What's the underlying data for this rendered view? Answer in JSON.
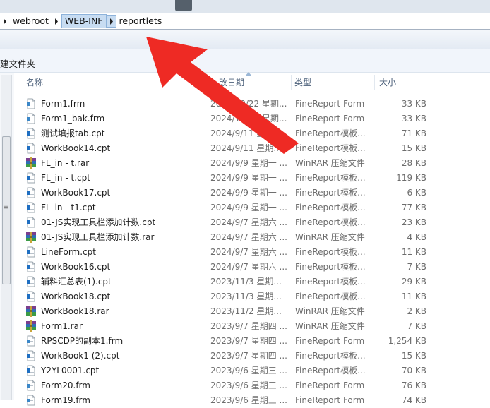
{
  "breadcrumb": {
    "items": [
      {
        "label": "webroot",
        "active": false
      },
      {
        "label": "WEB-INF",
        "active": true
      },
      {
        "label": "reportlets",
        "active": false
      }
    ]
  },
  "commandbar": {
    "new_folder": "建文件夹"
  },
  "columns": {
    "name": "名称",
    "date": "改日期",
    "type": "类型",
    "size": "大小"
  },
  "files": [
    {
      "name": "Form1.frm",
      "date": "2024/10/22 星期...",
      "type": "FineReport Form",
      "size": "33 KB",
      "icon": "frm-file-icon"
    },
    {
      "name": "Form1_bak.frm",
      "date": "2024/10/22 星期...",
      "type": "FineReport Form",
      "size": "33 KB",
      "icon": "frm-file-icon"
    },
    {
      "name": "测试填报tab.cpt",
      "date": "2024/9/11 星期...",
      "type": "FineReport模板...",
      "size": "71 KB",
      "icon": "cpt-file-icon"
    },
    {
      "name": "WorkBook14.cpt",
      "date": "2024/9/11 星期...",
      "type": "FineReport模板...",
      "size": "15 KB",
      "icon": "cpt-file-icon"
    },
    {
      "name": "FL_in - t.rar",
      "date": "2024/9/9 星期一 ...",
      "type": "WinRAR 压缩文件",
      "size": "28 KB",
      "icon": "rar-file-icon"
    },
    {
      "name": "FL_in - t.cpt",
      "date": "2024/9/9 星期一 ...",
      "type": "FineReport模板...",
      "size": "119 KB",
      "icon": "cpt-file-icon"
    },
    {
      "name": "WorkBook17.cpt",
      "date": "2024/9/9 星期一 ...",
      "type": "FineReport模板...",
      "size": "6 KB",
      "icon": "cpt-file-icon"
    },
    {
      "name": "FL_in - t1.cpt",
      "date": "2024/9/9 星期一 ...",
      "type": "FineReport模板...",
      "size": "77 KB",
      "icon": "cpt-file-icon"
    },
    {
      "name": "01-JS实现工具栏添加计数.cpt",
      "date": "2024/9/7 星期六 ...",
      "type": "FineReport模板...",
      "size": "23 KB",
      "icon": "cpt-file-icon"
    },
    {
      "name": "01-JS实现工具栏添加计数.rar",
      "date": "2024/9/7 星期六 ...",
      "type": "WinRAR 压缩文件",
      "size": "4 KB",
      "icon": "rar-file-icon"
    },
    {
      "name": "LineForm.cpt",
      "date": "2024/9/7 星期六 ...",
      "type": "FineReport模板...",
      "size": "11 KB",
      "icon": "cpt-file-icon"
    },
    {
      "name": "WorkBook16.cpt",
      "date": "2024/9/7 星期六 ...",
      "type": "FineReport模板...",
      "size": "7 KB",
      "icon": "cpt-file-icon"
    },
    {
      "name": "辅料汇总表(1).cpt",
      "date": "2023/11/3 星期...",
      "type": "FineReport模板...",
      "size": "29 KB",
      "icon": "cpt-file-icon"
    },
    {
      "name": "WorkBook18.cpt",
      "date": "2023/11/3 星期...",
      "type": "FineReport模板...",
      "size": "11 KB",
      "icon": "cpt-file-icon"
    },
    {
      "name": "WorkBook18.rar",
      "date": "2023/11/2 星期...",
      "type": "WinRAR 压缩文件",
      "size": "2 KB",
      "icon": "rar-file-icon"
    },
    {
      "name": "Form1.rar",
      "date": "2023/9/7 星期四 ...",
      "type": "WinRAR 压缩文件",
      "size": "7 KB",
      "icon": "rar-file-icon"
    },
    {
      "name": "RPSCDP的副本1.frm",
      "date": "2023/9/7 星期四 ...",
      "type": "FineReport Form",
      "size": "1,254 KB",
      "icon": "frm-file-icon"
    },
    {
      "name": "WorkBook1 (2).cpt",
      "date": "2023/9/7 星期四 ...",
      "type": "FineReport模板...",
      "size": "15 KB",
      "icon": "cpt-file-icon"
    },
    {
      "name": "Y2YL0001.cpt",
      "date": "2023/9/6 星期三 ...",
      "type": "FineReport模板...",
      "size": "70 KB",
      "icon": "cpt-file-icon"
    },
    {
      "name": "Form20.frm",
      "date": "2023/9/6 星期三 ...",
      "type": "FineReport Form",
      "size": "76 KB",
      "icon": "frm-file-icon"
    },
    {
      "name": "Form19.frm",
      "date": "2023/9/6 星期三 ...",
      "type": "FineReport Form",
      "size": "74 KB",
      "icon": "frm-file-icon"
    }
  ],
  "annotation": {
    "arrow_color": "#ee2a24",
    "icon": "red-arrow-icon"
  }
}
